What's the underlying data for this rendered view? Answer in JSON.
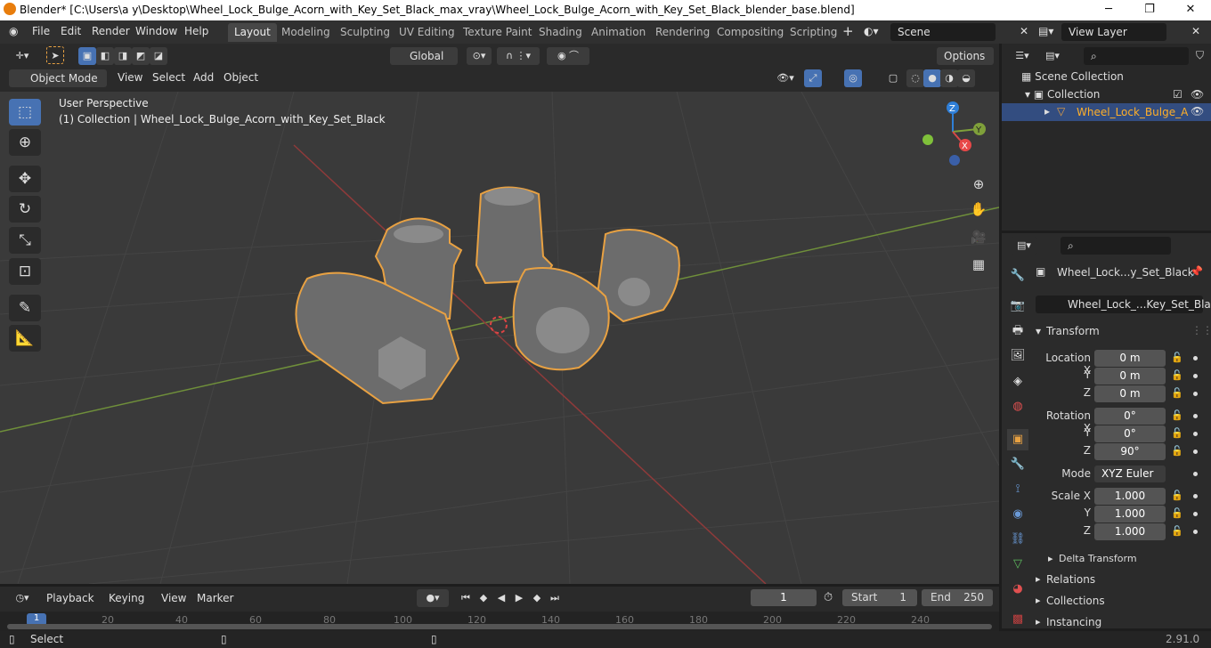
{
  "titlebar": {
    "title": "Blender* [C:\\Users\\a y\\Desktop\\Wheel_Lock_Bulge_Acorn_with_Key_Set_Black_max_vray\\Wheel_Lock_Bulge_Acorn_with_Key_Set_Black_blender_base.blend]",
    "minimize": "─",
    "maximize": "❐",
    "close": "✕"
  },
  "menus": [
    "File",
    "Edit",
    "Render",
    "Window",
    "Help"
  ],
  "workspaces": [
    "Layout",
    "Modeling",
    "Sculpting",
    "UV Editing",
    "Texture Paint",
    "Shading",
    "Animation",
    "Rendering",
    "Compositing",
    "Scripting"
  ],
  "scene": {
    "name": "Scene",
    "view_layer": "View Layer"
  },
  "toolheader": {
    "orientation": "Global",
    "options": "Options"
  },
  "viewport_header": {
    "mode": "Object Mode",
    "menus": [
      "View",
      "Select",
      "Add",
      "Object"
    ]
  },
  "viewport": {
    "perspective": "User Perspective",
    "collection_info": "(1) Collection | Wheel_Lock_Bulge_Acorn_with_Key_Set_Black"
  },
  "gizmo": {
    "x": "X",
    "y": "Y",
    "z": "Z"
  },
  "outliner": {
    "scene_collection": "Scene Collection",
    "collection": "Collection",
    "object": "Wheel_Lock_Bulge_A"
  },
  "properties": {
    "object_name": "Wheel_Lock...y_Set_Black",
    "data_name": "Wheel_Lock_...Key_Set_Black",
    "transform_title": "Transform",
    "location_label": "Location X",
    "rotation_label": "Rotation X",
    "scale_label": "Scale X",
    "y": "Y",
    "z": "Z",
    "location": [
      "0 m",
      "0 m",
      "0 m"
    ],
    "rotation": [
      "0°",
      "0°",
      "90°"
    ],
    "mode_label": "Mode",
    "mode_value": "XYZ Euler",
    "scale": [
      "1.000",
      "1.000",
      "1.000"
    ],
    "delta_transform": "Delta Transform",
    "sections": [
      "Relations",
      "Collections",
      "Instancing"
    ]
  },
  "timeline": {
    "menus": [
      "Playback",
      "Keying",
      "View",
      "Marker"
    ],
    "current_frame": "1",
    "start_label": "Start",
    "start": "1",
    "end_label": "End",
    "end": "250",
    "ruler": [
      "1",
      "20",
      "40",
      "60",
      "80",
      "100",
      "120",
      "140",
      "160",
      "180",
      "200",
      "220",
      "240"
    ]
  },
  "statusbar": {
    "left": "Select",
    "version": "2.91.0"
  },
  "colors": {
    "accent": "#4772b3",
    "selection": "#e8a142",
    "active": "#ffaf29"
  }
}
